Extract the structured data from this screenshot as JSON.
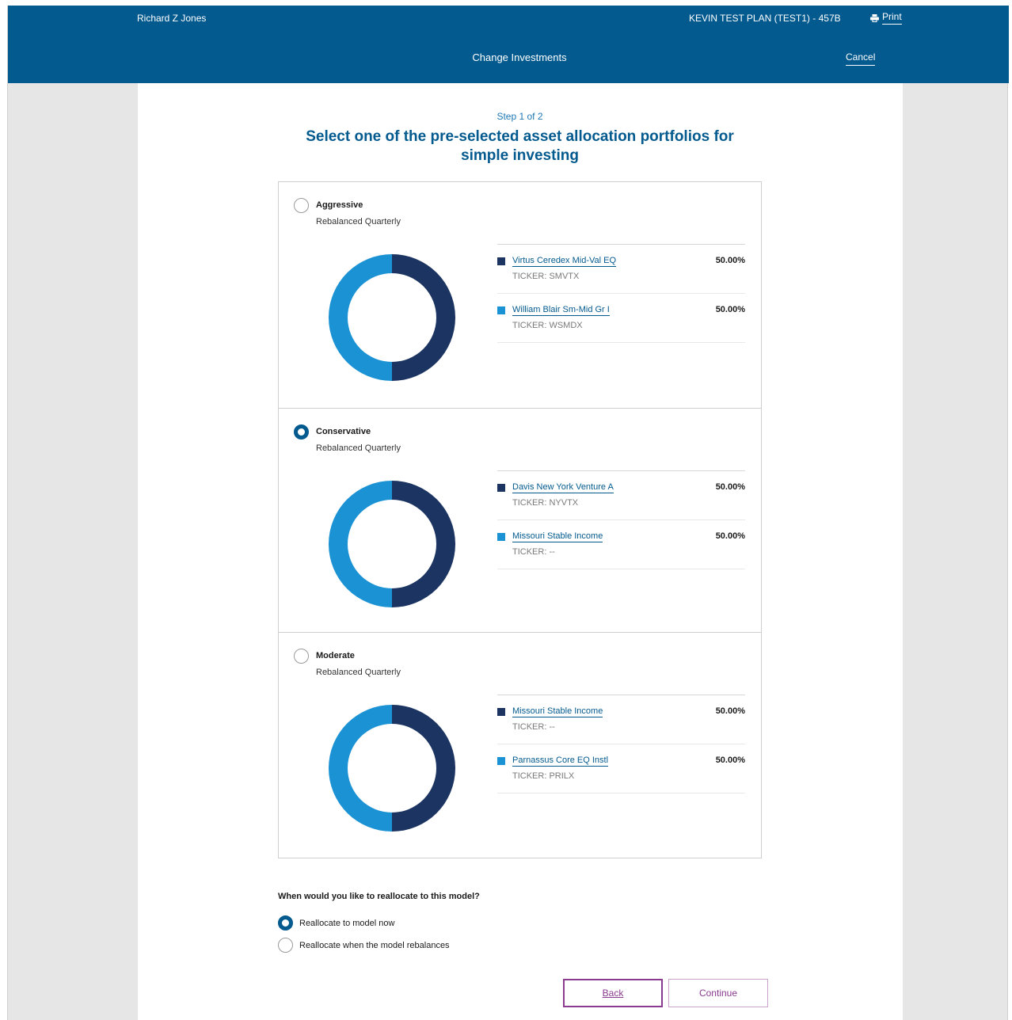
{
  "header": {
    "user": "Richard Z Jones",
    "plan": "KEVIN TEST PLAN (TEST1) - 457B",
    "print_label": "Print",
    "title": "Change Investments",
    "cancel_label": "Cancel"
  },
  "step": "Step 1 of 2",
  "heading": "Select one of the pre-selected asset allocation portfolios for simple investing",
  "colors": {
    "dark": "#1b3461",
    "light": "#1b92d4",
    "brand": "#035a8f",
    "accent": "#8a3a8f"
  },
  "portfolios": [
    {
      "name": "Aggressive",
      "subtitle": "Rebalanced Quarterly",
      "selected": false,
      "holdings": [
        {
          "name": "Virtus Ceredex Mid-Val EQ",
          "ticker": "TICKER: SMVTX",
          "percent": "50.00%",
          "value": 50
        },
        {
          "name": "William Blair Sm-Mid Gr I",
          "ticker": "TICKER: WSMDX",
          "percent": "50.00%",
          "value": 50
        }
      ]
    },
    {
      "name": "Conservative",
      "subtitle": "Rebalanced Quarterly",
      "selected": true,
      "holdings": [
        {
          "name": "Davis New York Venture A",
          "ticker": "TICKER: NYVTX",
          "percent": "50.00%",
          "value": 50
        },
        {
          "name": "Missouri Stable Income",
          "ticker": "TICKER: --",
          "percent": "50.00%",
          "value": 50
        }
      ]
    },
    {
      "name": "Moderate",
      "subtitle": "Rebalanced Quarterly",
      "selected": false,
      "holdings": [
        {
          "name": "Missouri Stable Income",
          "ticker": "TICKER: --",
          "percent": "50.00%",
          "value": 50
        },
        {
          "name": "Parnassus Core EQ Instl",
          "ticker": "TICKER: PRILX",
          "percent": "50.00%",
          "value": 50
        }
      ]
    }
  ],
  "reallocate": {
    "question": "When would you like to reallocate to this model?",
    "options": [
      {
        "label": "Reallocate to model now",
        "selected": true
      },
      {
        "label": "Reallocate when the model rebalances",
        "selected": false
      }
    ]
  },
  "buttons": {
    "back": "Back",
    "continue": "Continue"
  }
}
